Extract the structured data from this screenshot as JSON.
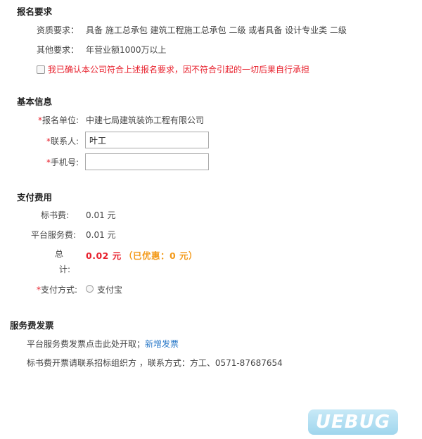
{
  "requirements": {
    "title": "报名要求",
    "qualification_label": "资质要求：",
    "qualification_value": "具备 施工总承包 建筑工程施工总承包 二级 或者具备 设计专业类 二级",
    "other_label": "其他要求：",
    "other_value": "年营业额1000万以上",
    "confirm_text": "我已确认本公司符合上述报名要求，因不符合引起的一切后果自行承担"
  },
  "basic_info": {
    "title": "基本信息",
    "required_mark": "*",
    "unit_label": "报名单位:",
    "unit_value": "中建七局建筑装饰工程有限公司",
    "contact_label": "联系人:",
    "contact_value": "叶工",
    "phone_label": "手机号:",
    "phone_value": ""
  },
  "payment": {
    "title": "支付费用",
    "bid_fee_label": "标书费:",
    "bid_fee_value": "0.01 元",
    "platform_fee_label": "平台服务费:",
    "platform_fee_value": "0.01 元",
    "total_label_1": "总",
    "total_label_2": "计:",
    "total_value": "0.02 元",
    "discount_text": "（已优惠：0 元）",
    "method_label": "支付方式:",
    "method_option": "支付宝"
  },
  "invoice": {
    "title": "服务费发票",
    "line1_text": "平台服务费发票点击此处开取；",
    "line1_link": "新增发票",
    "line2_text": "标书费开票请联系招标组织方 ，联系方式：方工、0571-87687654"
  },
  "watermark": {
    "text": "UEBUG"
  }
}
